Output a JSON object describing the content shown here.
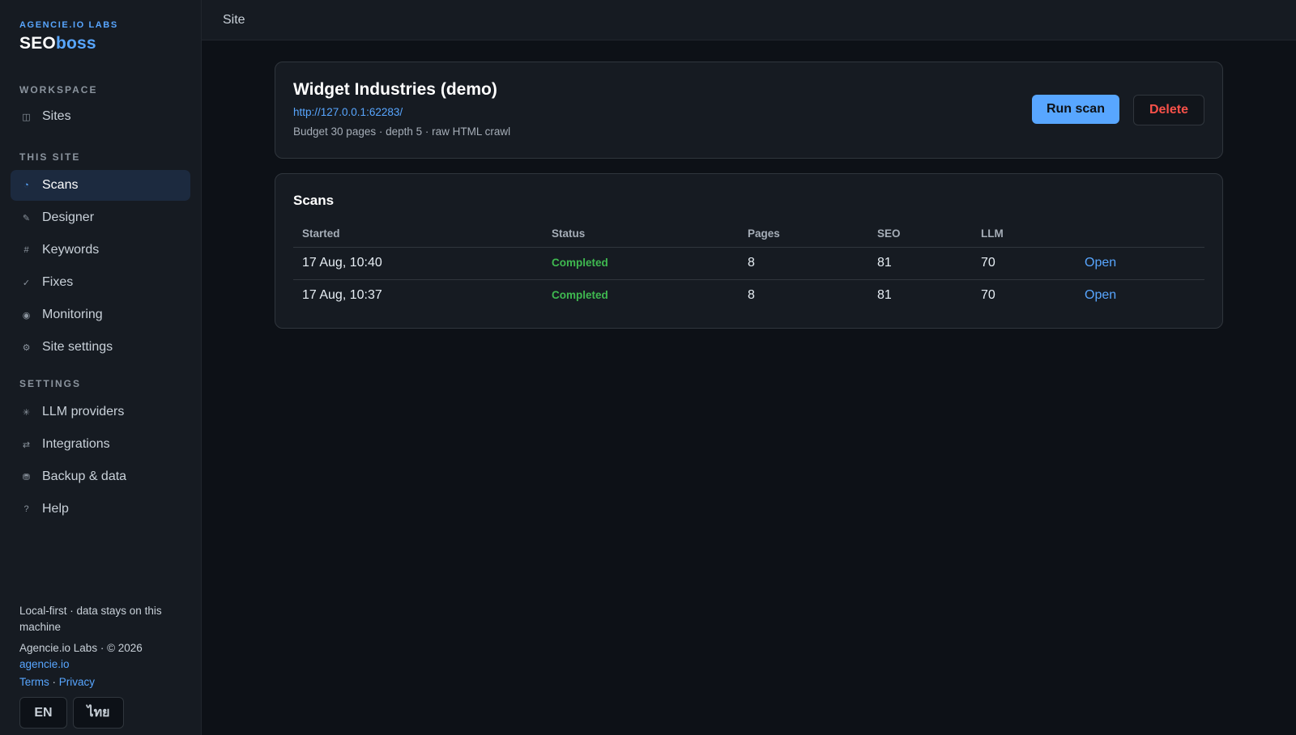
{
  "brand": {
    "company": "AGENCIE.IO LABS",
    "name_main": "SEO",
    "name_accent": "boss"
  },
  "sidebar": {
    "sections": [
      {
        "title": "WORKSPACE",
        "items": [
          {
            "label": "Sites",
            "icon": "◫",
            "icon_name": "grid-icon"
          }
        ]
      },
      {
        "title": "THIS SITE",
        "items": [
          {
            "label": "Scans",
            "icon": "◔",
            "icon_name": "scan-icon",
            "active": true
          },
          {
            "label": "Designer",
            "icon": "✎",
            "icon_name": "pencil-icon"
          },
          {
            "label": "Keywords",
            "icon": "#",
            "icon_name": "hash-icon"
          },
          {
            "label": "Fixes",
            "icon": "✓",
            "icon_name": "check-icon"
          },
          {
            "label": "Monitoring",
            "icon": "◉",
            "icon_name": "monitor-icon"
          },
          {
            "label": "Site settings",
            "icon": "⚙",
            "icon_name": "gear-icon"
          }
        ]
      },
      {
        "title": "SETTINGS",
        "items": [
          {
            "label": "LLM providers",
            "icon": "✳",
            "icon_name": "sparkle-icon"
          },
          {
            "label": "Integrations",
            "icon": "⇄",
            "icon_name": "swap-icon"
          },
          {
            "label": "Backup & data",
            "icon": "⛃",
            "icon_name": "database-icon"
          },
          {
            "label": "Help",
            "icon": "?",
            "icon_name": "help-icon"
          }
        ]
      }
    ],
    "footer": {
      "tagline": "Local-first · data stays on this machine",
      "copyright": "Agencie.io Labs · © 2026",
      "website": "agencie.io",
      "terms": "Terms",
      "separator": " · ",
      "privacy": "Privacy",
      "languages": [
        "EN",
        "ไทย"
      ]
    }
  },
  "topbar": {
    "title": "Site"
  },
  "site": {
    "name": "Widget Industries (demo)",
    "url": "http://127.0.0.1:62283/",
    "meta": "Budget 30 pages · depth 5 · raw HTML crawl",
    "run_label": "Run scan",
    "delete_label": "Delete"
  },
  "scans": {
    "title": "Scans",
    "columns": [
      "Started",
      "Status",
      "Pages",
      "SEO",
      "LLM",
      ""
    ],
    "rows": [
      {
        "started": "17 Aug, 10:40",
        "status": "Completed",
        "pages": "8",
        "seo": "81",
        "llm": "70",
        "action": "Open"
      },
      {
        "started": "17 Aug, 10:37",
        "status": "Completed",
        "pages": "8",
        "seo": "81",
        "llm": "70",
        "action": "Open"
      }
    ]
  },
  "colors": {
    "accent": "#58a6ff",
    "success": "#3fb950",
    "danger": "#f85149",
    "background": "#0d1117",
    "panel": "#161b22"
  }
}
